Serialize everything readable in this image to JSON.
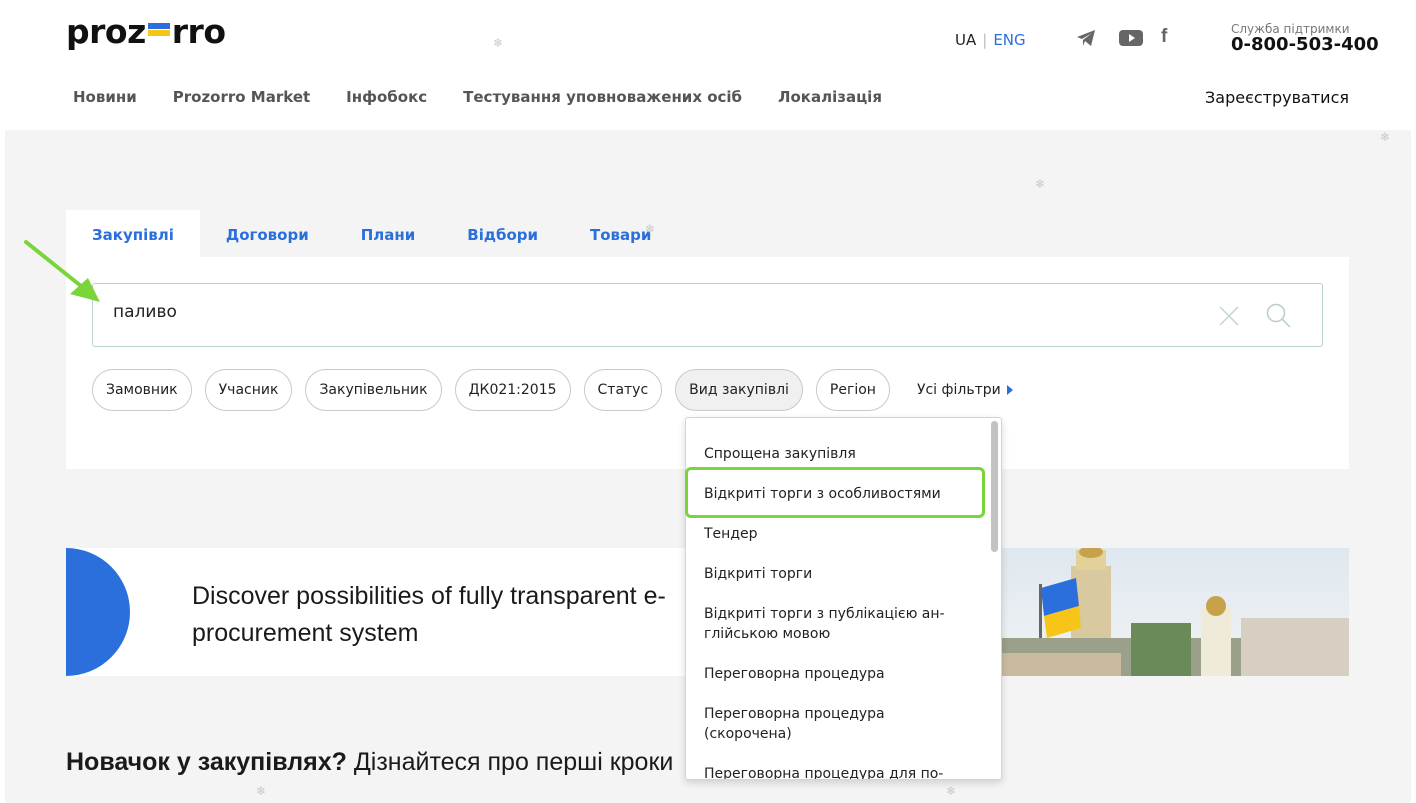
{
  "header": {
    "logo_left": "proz",
    "logo_right": "rro",
    "lang_ua": "UA",
    "lang_sep": "|",
    "lang_en": "ENG",
    "support_label": "Служба підтримки",
    "support_phone": "0-800-503-400",
    "register": "Зареєструватися"
  },
  "nav": [
    "Новини",
    "Prozorro Market",
    "Інфобокс",
    "Тестування уповноважених осіб",
    "Локалізація"
  ],
  "tabs": [
    "Закупівлі",
    "Договори",
    "Плани",
    "Відбори",
    "Товари"
  ],
  "search": {
    "value": "паливо"
  },
  "filters": [
    "Замовник",
    "Учасник",
    "Закупівельник",
    "ДК021:2015",
    "Статус",
    "Вид закупівлі",
    "Регіон"
  ],
  "all_filters": "Усі фільтри",
  "dropdown": {
    "items": [
      "Спрощена закупівля",
      "Відкриті торги з особливостями",
      "Тендер",
      "Відкриті торги",
      "Відкриті торги з публікацією ан-\nглійською мовою",
      "Переговорна процедура",
      "Переговорна процедура\n(скорочена)",
      "Переговорна процедура для по-"
    ]
  },
  "banner": {
    "text": "Discover possibilities of fully transparent e-procurement system"
  },
  "newcomer": {
    "bold": "Новачок у закупівлях?",
    "rest": " Дізнайтеся про перші кроки"
  },
  "colors": {
    "accent": "#2a6fdb",
    "highlight": "#7ad53a",
    "flag_yellow": "#f6c518"
  }
}
